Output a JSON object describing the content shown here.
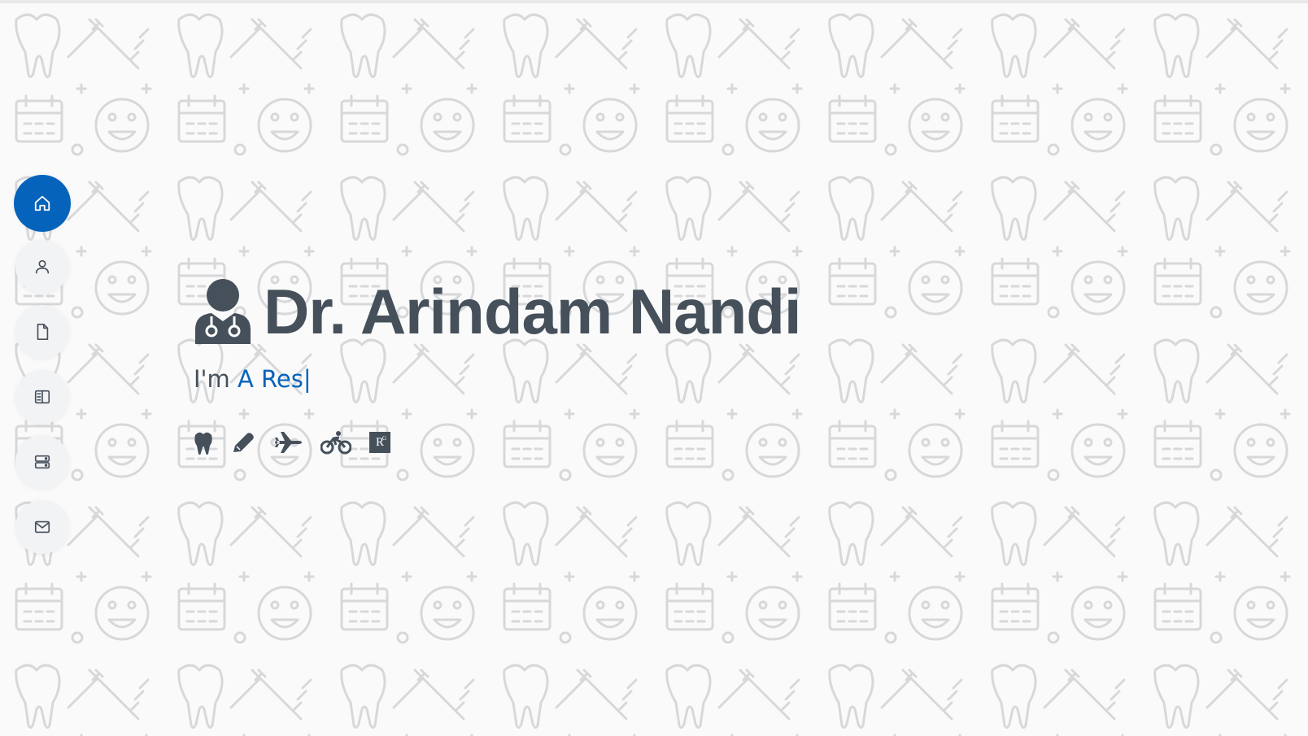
{
  "hero": {
    "name": "Dr. Arindam Nandi",
    "subtitle_prefix": "I'm",
    "typed_text": "A Res",
    "cursor": "|"
  },
  "nav": {
    "items": [
      {
        "icon": "home-icon",
        "active": true
      },
      {
        "icon": "person-icon",
        "active": false
      },
      {
        "icon": "file-icon",
        "active": false
      },
      {
        "icon": "book-half-icon",
        "active": false
      },
      {
        "icon": "server-icon",
        "active": false
      },
      {
        "icon": "envelope-icon",
        "active": false
      }
    ]
  },
  "social": {
    "items": [
      "tooth-icon",
      "pencil-icon",
      "airplane-icon",
      "bicycle-icon",
      "researchgate-icon"
    ],
    "researchgate_label": "R",
    "researchgate_sup": "G"
  },
  "colors": {
    "accent": "#0563bb",
    "text": "#45505b",
    "nav_bg": "#f2f3f5",
    "pattern_stroke": "#c9cbcf"
  }
}
